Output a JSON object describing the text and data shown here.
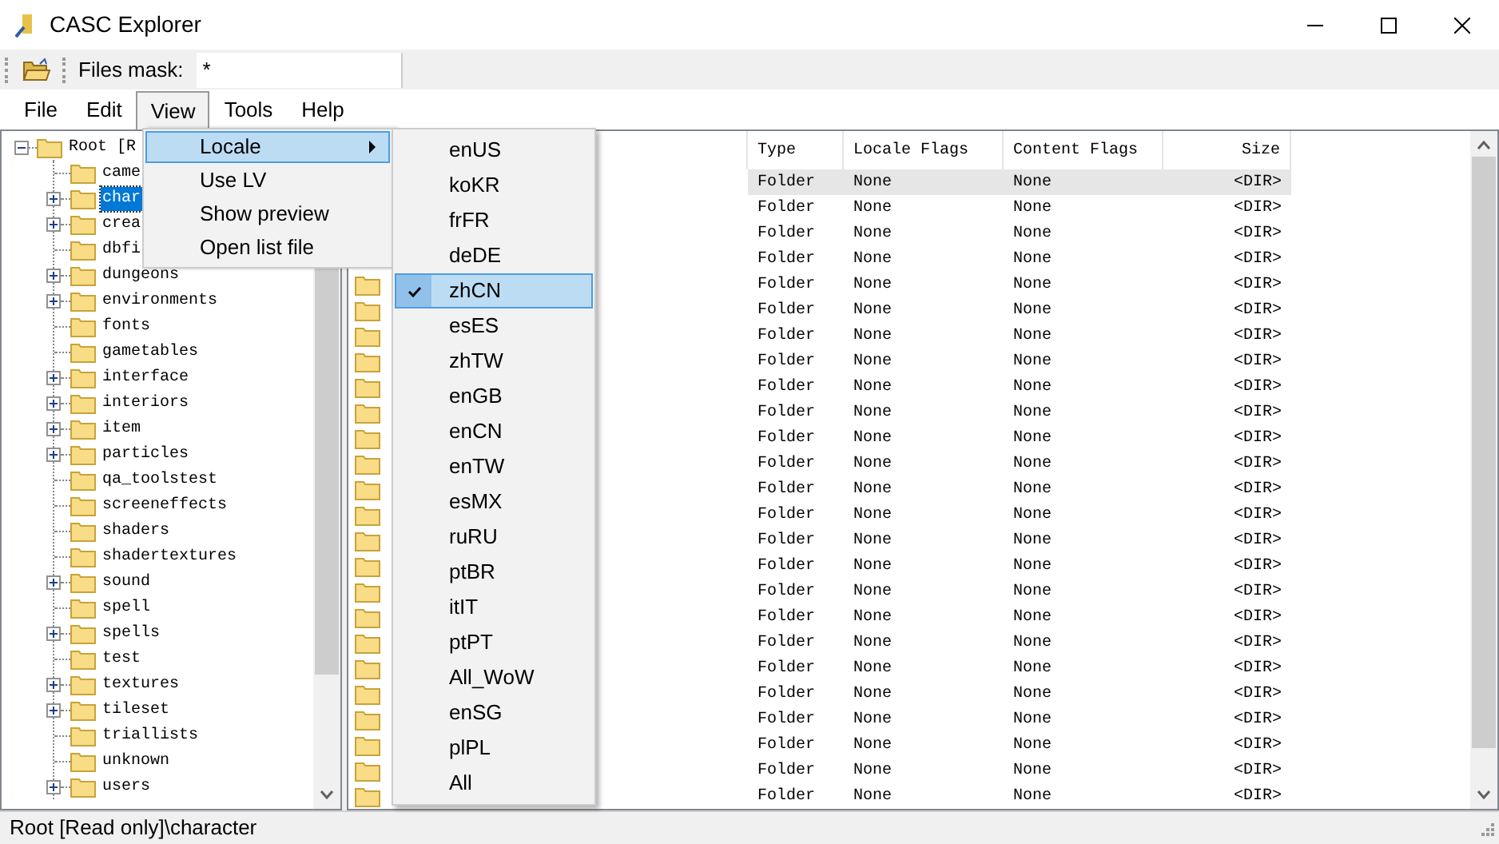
{
  "window": {
    "title": "CASC Explorer"
  },
  "toolbar": {
    "mask_label": "Files mask:",
    "mask_value": "*"
  },
  "menu_bar": [
    {
      "label": "File",
      "selected": false
    },
    {
      "label": "Edit",
      "selected": false
    },
    {
      "label": "View",
      "selected": true
    },
    {
      "label": "Tools",
      "selected": false
    },
    {
      "label": "Help",
      "selected": false
    }
  ],
  "view_menu": [
    {
      "label": "Locale",
      "kind": "submenu",
      "selected": true
    },
    {
      "label": "Use LV",
      "kind": "item",
      "selected": false
    },
    {
      "label": "Show preview",
      "kind": "item",
      "selected": false
    },
    {
      "label": "Open list file",
      "kind": "item",
      "selected": false
    }
  ],
  "locale_menu": [
    {
      "label": "enUS",
      "checked": false,
      "selected": false
    },
    {
      "label": "koKR",
      "checked": false,
      "selected": false
    },
    {
      "label": "frFR",
      "checked": false,
      "selected": false
    },
    {
      "label": "deDE",
      "checked": false,
      "selected": false
    },
    {
      "label": "zhCN",
      "checked": true,
      "selected": true
    },
    {
      "label": "esES",
      "checked": false,
      "selected": false
    },
    {
      "label": "zhTW",
      "checked": false,
      "selected": false
    },
    {
      "label": "enGB",
      "checked": false,
      "selected": false
    },
    {
      "label": "enCN",
      "checked": false,
      "selected": false
    },
    {
      "label": "enTW",
      "checked": false,
      "selected": false
    },
    {
      "label": "esMX",
      "checked": false,
      "selected": false
    },
    {
      "label": "ruRU",
      "checked": false,
      "selected": false
    },
    {
      "label": "ptBR",
      "checked": false,
      "selected": false
    },
    {
      "label": "itIT",
      "checked": false,
      "selected": false
    },
    {
      "label": "ptPT",
      "checked": false,
      "selected": false
    },
    {
      "label": "All_WoW",
      "checked": false,
      "selected": false
    },
    {
      "label": "enSG",
      "checked": false,
      "selected": false
    },
    {
      "label": "plPL",
      "checked": false,
      "selected": false
    },
    {
      "label": "All",
      "checked": false,
      "selected": false
    }
  ],
  "tree": {
    "label": "Root [R",
    "expanded": true,
    "children": [
      {
        "label": "came",
        "expandable": false,
        "selected": false
      },
      {
        "label": "char",
        "expandable": true,
        "selected": true
      },
      {
        "label": "crea",
        "expandable": true,
        "selected": false
      },
      {
        "label": "dbfi",
        "expandable": false,
        "selected": false
      },
      {
        "label": "dungeons",
        "expandable": true,
        "selected": false
      },
      {
        "label": "environments",
        "expandable": true,
        "selected": false
      },
      {
        "label": "fonts",
        "expandable": false,
        "selected": false
      },
      {
        "label": "gametables",
        "expandable": false,
        "selected": false
      },
      {
        "label": "interface",
        "expandable": true,
        "selected": false
      },
      {
        "label": "interiors",
        "expandable": true,
        "selected": false
      },
      {
        "label": "item",
        "expandable": true,
        "selected": false
      },
      {
        "label": "particles",
        "expandable": true,
        "selected": false
      },
      {
        "label": "qa_toolstest",
        "expandable": false,
        "selected": false
      },
      {
        "label": "screeneffects",
        "expandable": false,
        "selected": false
      },
      {
        "label": "shaders",
        "expandable": false,
        "selected": false
      },
      {
        "label": "shadertextures",
        "expandable": false,
        "selected": false
      },
      {
        "label": "sound",
        "expandable": true,
        "selected": false
      },
      {
        "label": "spell",
        "expandable": false,
        "selected": false
      },
      {
        "label": "spells",
        "expandable": true,
        "selected": false
      },
      {
        "label": "test",
        "expandable": false,
        "selected": false
      },
      {
        "label": "textures",
        "expandable": true,
        "selected": false
      },
      {
        "label": "tileset",
        "expandable": true,
        "selected": false
      },
      {
        "label": "triallists",
        "expandable": false,
        "selected": false
      },
      {
        "label": "unknown",
        "expandable": false,
        "selected": false
      },
      {
        "label": "users",
        "expandable": true,
        "selected": false
      }
    ]
  },
  "file_list": {
    "columns": [
      "Type",
      "Locale Flags",
      "Content Flags",
      "Size"
    ],
    "rows": [
      {
        "type": "Folder",
        "locale_flags": "None",
        "content_flags": "None",
        "size": "<DIR>",
        "selected": true
      },
      {
        "type": "Folder",
        "locale_flags": "None",
        "content_flags": "None",
        "size": "<DIR>",
        "selected": false
      },
      {
        "type": "Folder",
        "locale_flags": "None",
        "content_flags": "None",
        "size": "<DIR>",
        "selected": false
      },
      {
        "type": "Folder",
        "locale_flags": "None",
        "content_flags": "None",
        "size": "<DIR>",
        "selected": false
      },
      {
        "type": "Folder",
        "locale_flags": "None",
        "content_flags": "None",
        "size": "<DIR>",
        "selected": false
      },
      {
        "type": "Folder",
        "locale_flags": "None",
        "content_flags": "None",
        "size": "<DIR>",
        "selected": false
      },
      {
        "type": "Folder",
        "locale_flags": "None",
        "content_flags": "None",
        "size": "<DIR>",
        "selected": false
      },
      {
        "type": "Folder",
        "locale_flags": "None",
        "content_flags": "None",
        "size": "<DIR>",
        "selected": false
      },
      {
        "type": "Folder",
        "locale_flags": "None",
        "content_flags": "None",
        "size": "<DIR>",
        "selected": false
      },
      {
        "type": "Folder",
        "locale_flags": "None",
        "content_flags": "None",
        "size": "<DIR>",
        "selected": false
      },
      {
        "type": "Folder",
        "locale_flags": "None",
        "content_flags": "None",
        "size": "<DIR>",
        "selected": false
      },
      {
        "type": "Folder",
        "locale_flags": "None",
        "content_flags": "None",
        "size": "<DIR>",
        "selected": false
      },
      {
        "type": "Folder",
        "locale_flags": "None",
        "content_flags": "None",
        "size": "<DIR>",
        "selected": false
      },
      {
        "type": "Folder",
        "locale_flags": "None",
        "content_flags": "None",
        "size": "<DIR>",
        "selected": false
      },
      {
        "type": "Folder",
        "locale_flags": "None",
        "content_flags": "None",
        "size": "<DIR>",
        "selected": false
      },
      {
        "type": "Folder",
        "locale_flags": "None",
        "content_flags": "None",
        "size": "<DIR>",
        "selected": false
      },
      {
        "type": "Folder",
        "locale_flags": "None",
        "content_flags": "None",
        "size": "<DIR>",
        "selected": false
      },
      {
        "type": "Folder",
        "locale_flags": "None",
        "content_flags": "None",
        "size": "<DIR>",
        "selected": false
      },
      {
        "type": "Folder",
        "locale_flags": "None",
        "content_flags": "None",
        "size": "<DIR>",
        "selected": false
      },
      {
        "type": "Folder",
        "locale_flags": "None",
        "content_flags": "None",
        "size": "<DIR>",
        "selected": false
      },
      {
        "type": "Folder",
        "locale_flags": "None",
        "content_flags": "None",
        "size": "<DIR>",
        "selected": false
      },
      {
        "type": "Folder",
        "locale_flags": "None",
        "content_flags": "None",
        "size": "<DIR>",
        "selected": false
      },
      {
        "type": "Folder",
        "locale_flags": "None",
        "content_flags": "None",
        "size": "<DIR>",
        "selected": false
      },
      {
        "type": "Folder",
        "locale_flags": "None",
        "content_flags": "None",
        "size": "<DIR>",
        "selected": false
      },
      {
        "type": "Folder",
        "locale_flags": "None",
        "content_flags": "None",
        "size": "<DIR>",
        "selected": false
      }
    ]
  },
  "status_bar": "Root [Read only]\\character"
}
